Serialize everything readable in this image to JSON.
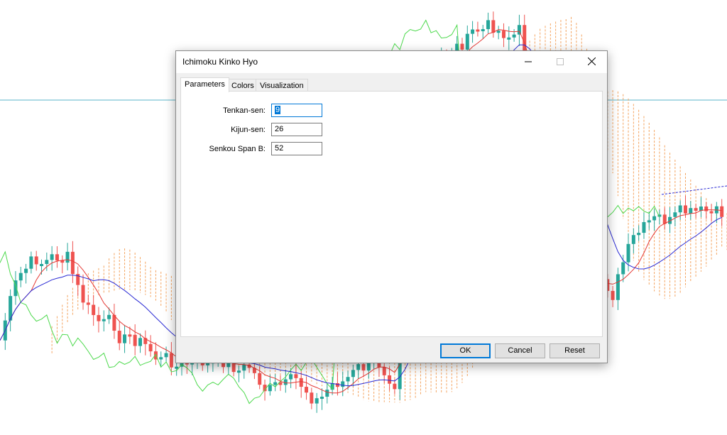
{
  "chart": {
    "colors": {
      "bull_candle": "#26a69a",
      "bear_candle": "#ef5350",
      "tenkan_line": "#e53935",
      "kijun_line": "#2a2ad4",
      "chikou_line": "#4cd94c",
      "cloud": "#f4a460",
      "horizontal_line": "#5ab4c8"
    }
  },
  "dialog": {
    "title": "Ichimoku Kinko Hyo",
    "window_buttons": {
      "minimize_icon": "minimize-icon",
      "maximize_icon": "maximize-icon",
      "close_icon": "close-icon"
    },
    "tabs": [
      {
        "label": "Parameters",
        "active": true
      },
      {
        "label": "Colors",
        "active": false
      },
      {
        "label": "Visualization",
        "active": false
      }
    ],
    "parameters": [
      {
        "label": "Tenkan-sen:",
        "value": "9"
      },
      {
        "label": "Kijun-sen:",
        "value": "26"
      },
      {
        "label": "Senkou Span B:",
        "value": "52"
      }
    ],
    "buttons": {
      "ok": "OK",
      "cancel": "Cancel",
      "reset": "Reset"
    }
  }
}
